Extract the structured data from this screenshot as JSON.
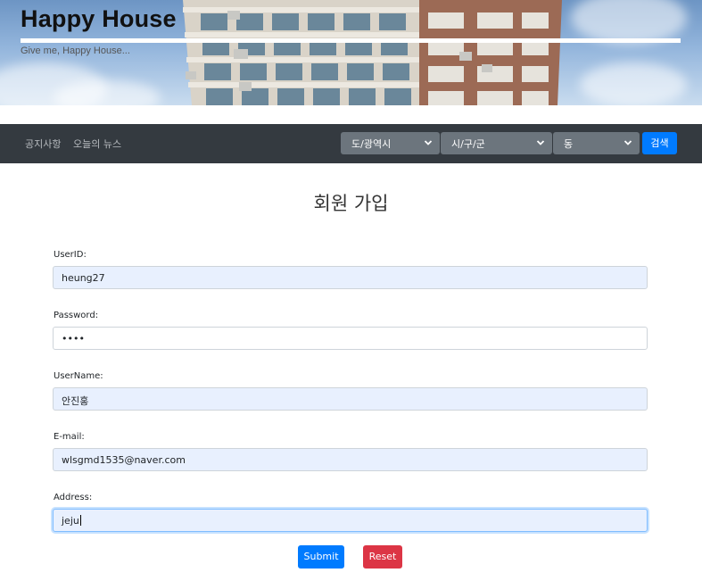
{
  "header": {
    "title": "Happy House",
    "subtitle": "Give me, Happy House..."
  },
  "nav": {
    "links": [
      {
        "label": "공지사항"
      },
      {
        "label": "오늘의 뉴스"
      }
    ],
    "selects": [
      {
        "label": "도/광역시"
      },
      {
        "label": "시/구/군"
      },
      {
        "label": "동"
      }
    ],
    "search_label": "검색"
  },
  "form": {
    "heading": "회원 가입",
    "fields": [
      {
        "label": "UserID:",
        "value": "heung27"
      },
      {
        "label": "Password:",
        "value": "••••"
      },
      {
        "label": "UserName:",
        "value": "안진홍"
      },
      {
        "label": "E-mail:",
        "value": "wlsgmd1535@naver.com"
      },
      {
        "label": "Address:",
        "value": "jeju"
      }
    ],
    "submit_label": "Submit",
    "reset_label": "Reset"
  },
  "colors": {
    "navbar": "#343a40",
    "primary": "#007bff",
    "danger": "#dc3545",
    "autofill": "#e8f0fe"
  }
}
